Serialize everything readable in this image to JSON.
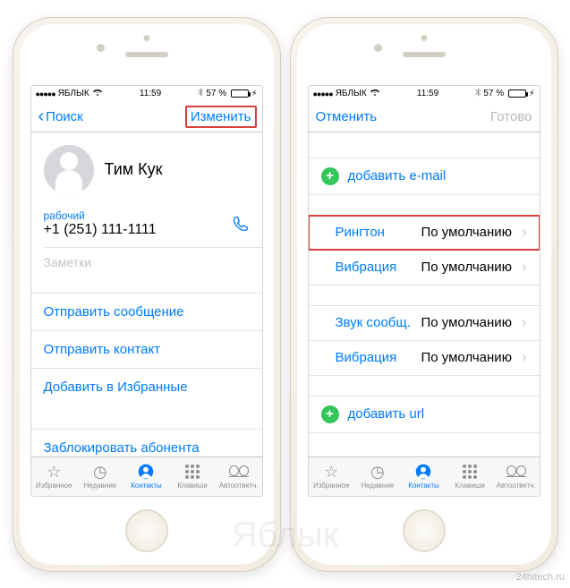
{
  "watermark": {
    "center": "Яблык",
    "site": "24hitech.ru"
  },
  "statusbar": {
    "carrier": "ЯБЛЫК",
    "time": "11:59",
    "battery_pct": "57 %"
  },
  "left_screen": {
    "nav": {
      "back": "Поиск",
      "edit": "Изменить"
    },
    "contact": {
      "name": "Тим Кук",
      "phone_label": "рабочий",
      "phone_number": "+1 (251) 111-1111",
      "notes_label": "Заметки"
    },
    "actions": {
      "send_message": "Отправить сообщение",
      "send_contact": "Отправить контакт",
      "add_favorite": "Добавить в Избранные",
      "block": "Заблокировать абонента"
    }
  },
  "right_screen": {
    "nav": {
      "cancel": "Отменить",
      "done": "Готово"
    },
    "add_email": "добавить e-mail",
    "add_url": "добавить url",
    "ringtone": {
      "label": "Рингтон",
      "value": "По умолчанию"
    },
    "vibration": {
      "label": "Вибрация",
      "value": "По умолчанию"
    },
    "text_tone": {
      "label": "Звук сообщ.",
      "value": "По умолчанию"
    },
    "text_vibration": {
      "label": "Вибрация",
      "value": "По умолчанию"
    }
  },
  "tabs": {
    "favorites": "Избранное",
    "recents": "Недавние",
    "contacts": "Контакты",
    "keypad": "Клавиши",
    "voicemail": "Автоответч."
  }
}
